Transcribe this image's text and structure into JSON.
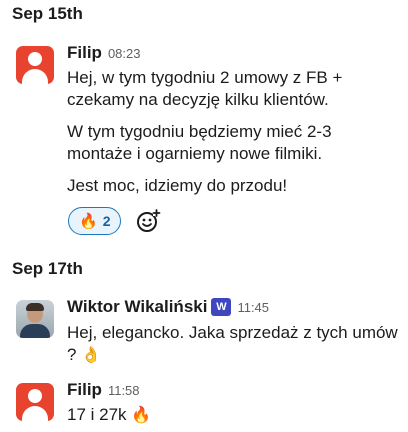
{
  "day_dividers": [
    "Sep 15th",
    "Sep 17th"
  ],
  "messages": [
    {
      "author": "Filip",
      "time": "08:23",
      "paragraphs": [
        "Hej, w tym tygodniu 2 umowy z FB + czekamy na decyzję kilku klientów.",
        "W tym tygodniu będziemy mieć 2-3 montaże i ogarniemy nowe filmiki.",
        "Jest moc, idziemy do przodu!"
      ],
      "reaction": {
        "emoji": "🔥",
        "count": "2"
      }
    },
    {
      "author": "Wiktor Wikaliński",
      "badge": "W",
      "time": "11:45",
      "text": "Hej, elegancko. Jaka sprzedaż z tych umów ?",
      "emoji": "👌"
    },
    {
      "author": "Filip",
      "time": "11:58",
      "text": "17 i 27k",
      "emoji": "🔥"
    }
  ],
  "icons": {
    "add_reaction": "add-reaction-icon",
    "avatar_default": "default-avatar-icon"
  },
  "colors": {
    "avatar_red": "#e8432f",
    "reaction_border": "#1d79bf",
    "reaction_bg": "#e8f3fb",
    "badge_blue": "#3f47c0"
  }
}
